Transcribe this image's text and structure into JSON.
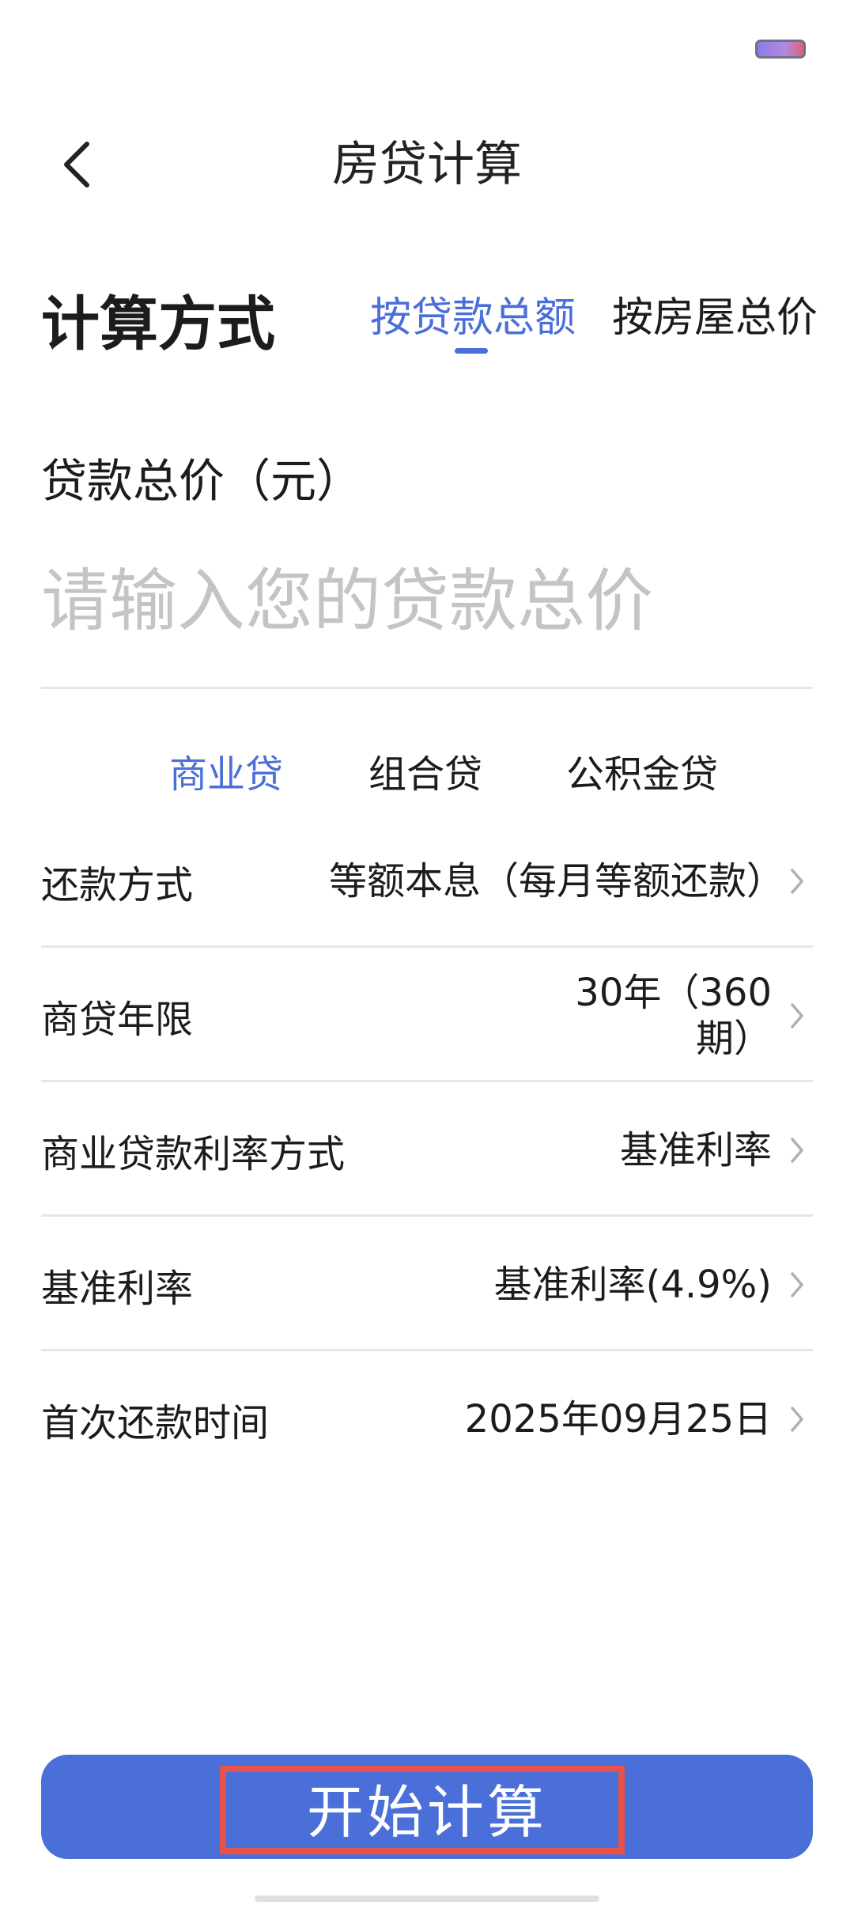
{
  "header": {
    "title": "房贷计算"
  },
  "calc_method": {
    "label": "计算方式",
    "tabs": [
      {
        "label": "按贷款总额",
        "active": true
      },
      {
        "label": "按房屋总价",
        "active": false
      }
    ]
  },
  "loan_amount": {
    "label": "贷款总价（元）",
    "placeholder": "请输入您的贷款总价",
    "value": ""
  },
  "loan_types": [
    {
      "label": "商业贷",
      "active": true
    },
    {
      "label": "组合贷",
      "active": false
    },
    {
      "label": "公积金贷",
      "active": false
    }
  ],
  "settings": [
    {
      "label": "还款方式",
      "value": "等额本息（每月等额还款）"
    },
    {
      "label": "商贷年限",
      "value": "30年（360期）"
    },
    {
      "label": "商业贷款利率方式",
      "value": "基准利率"
    },
    {
      "label": "基准利率",
      "value": "基准利率(4.9%)"
    },
    {
      "label": "首次还款时间",
      "value": "2025年09月25日"
    }
  ],
  "button": {
    "label": "开始计算"
  },
  "icons": {
    "back": "chevron-left-icon",
    "row": "chevron-right-icon"
  },
  "colors": {
    "accent": "#4a6fd8",
    "highlight": "#e5534b"
  }
}
